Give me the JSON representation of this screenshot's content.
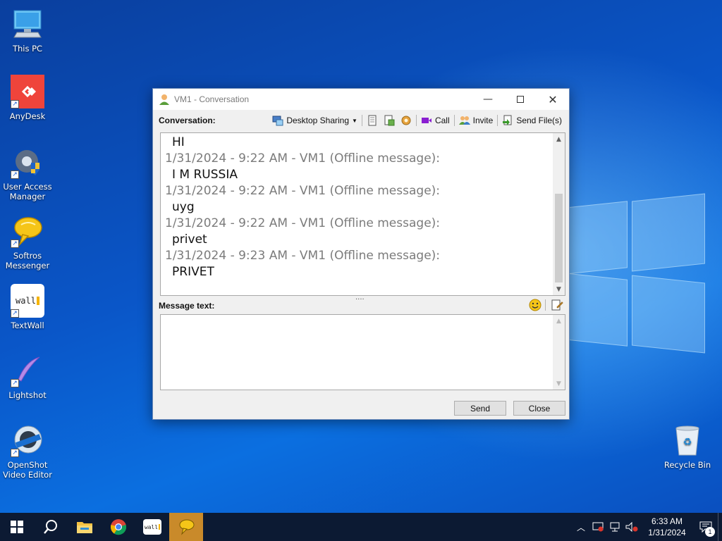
{
  "desktop_icons": [
    {
      "id": "this-pc",
      "label": "This PC"
    },
    {
      "id": "anydesk",
      "label": "AnyDesk"
    },
    {
      "id": "uam",
      "label": "User Access Manager"
    },
    {
      "id": "softros",
      "label": "Softros Messenger"
    },
    {
      "id": "textwall",
      "label": "TextWall"
    },
    {
      "id": "lightshot",
      "label": "Lightshot"
    },
    {
      "id": "openshot",
      "label": "OpenShot Video Editor"
    },
    {
      "id": "recycle",
      "label": "Recycle Bin"
    }
  ],
  "textwall_logo_text": "wall",
  "window": {
    "title": "VM1 - Conversation",
    "conversation_label": "Conversation:",
    "message_label": "Message text:",
    "toolbar": {
      "desktop_sharing": "Desktop Sharing",
      "call": "Call",
      "invite": "Invite",
      "send_files": "Send File(s)"
    },
    "messages": [
      {
        "type": "text",
        "value": "HI"
      },
      {
        "type": "header",
        "value": "1/31/2024 - 9:22 AM - VM1 (Offline message):"
      },
      {
        "type": "text",
        "value": "I M RUSSIA"
      },
      {
        "type": "header",
        "value": "1/31/2024 - 9:22 AM - VM1 (Offline message):"
      },
      {
        "type": "text",
        "value": "uyg"
      },
      {
        "type": "header",
        "value": "1/31/2024 - 9:22 AM - VM1 (Offline message):"
      },
      {
        "type": "text",
        "value": "privet"
      },
      {
        "type": "header",
        "value": "1/31/2024 - 9:23 AM - VM1 (Offline message):"
      },
      {
        "type": "text",
        "value": "PRIVET"
      }
    ],
    "message_input_value": "",
    "send_label": "Send",
    "close_label": "Close",
    "splitter_glyph": "····"
  },
  "taskbar": {
    "clock_time": "6:33 AM",
    "clock_date": "1/31/2024",
    "notification_count": "1"
  },
  "colors": {
    "taskbar": "#0c1a33",
    "active_app": "#c98a2a",
    "anydesk_red": "#ef443b",
    "call_purple": "#8a1fd1"
  }
}
